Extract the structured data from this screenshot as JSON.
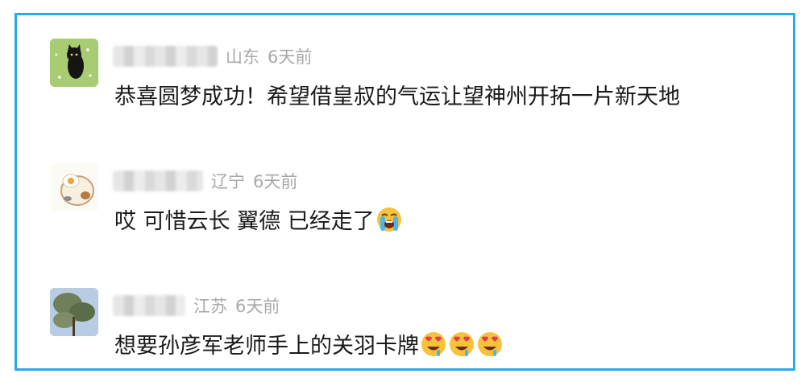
{
  "comments": [
    {
      "location": "山东",
      "time": "6天前",
      "text": "恭喜圆梦成功！希望借皇叔的气运让望神州开拓一片新天地",
      "avatar_icon": "black-cat-on-grass-avatar",
      "emojis": []
    },
    {
      "location": "辽宁",
      "time": "6天前",
      "text": "哎 可惜云长 翼德 已经走了",
      "avatar_icon": "fried-egg-cat-avatar",
      "emojis": [
        "loudly-crying-face"
      ]
    },
    {
      "location": "江苏",
      "time": "6天前",
      "text": "想要孙彦军老师手上的关羽卡牌",
      "avatar_icon": "tree-sky-avatar",
      "emojis": [
        "drooling-heart-eyes-face",
        "drooling-heart-eyes-face",
        "drooling-heart-eyes-face"
      ]
    }
  ],
  "colors": {
    "border": "#29a9e8",
    "meta": "#a9a9a9",
    "text": "#1a1a1a"
  }
}
